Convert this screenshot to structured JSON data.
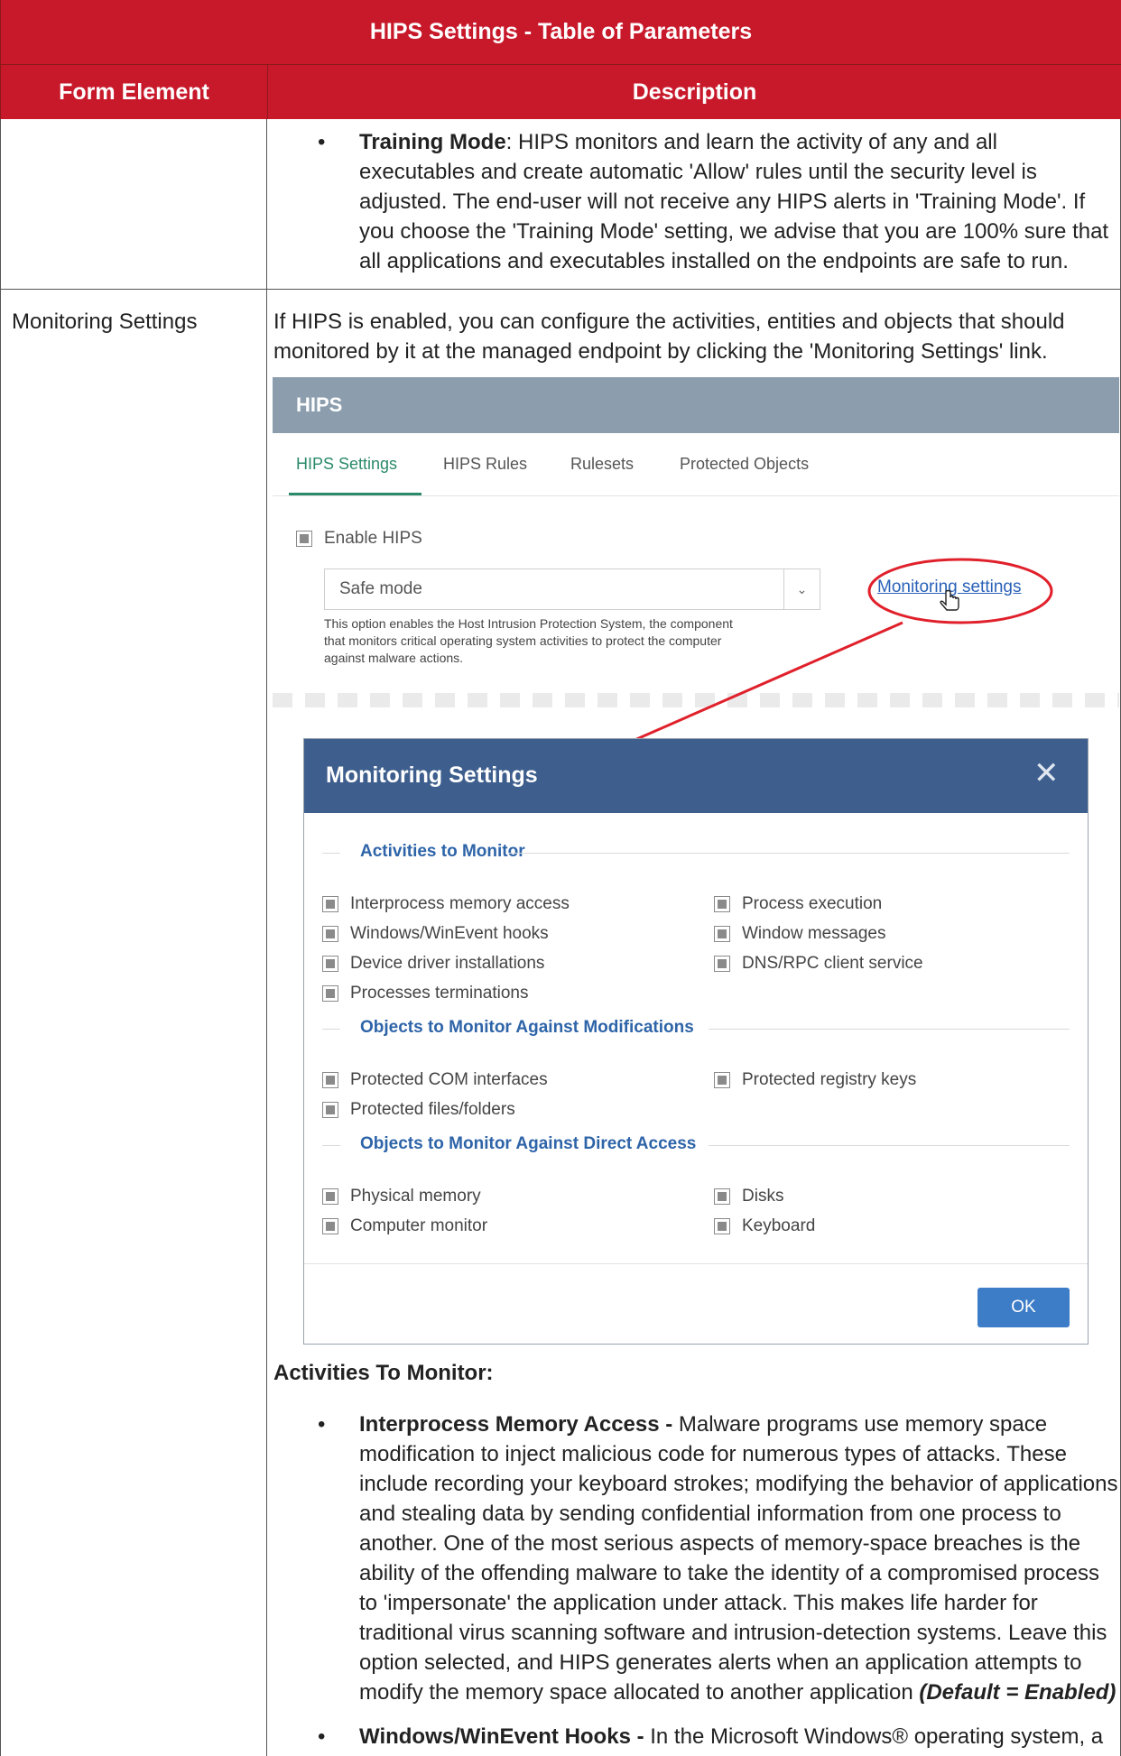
{
  "table": {
    "title": "HIPS Settings - Table of Parameters",
    "col_form": "Form Element",
    "col_desc": "Description"
  },
  "training": {
    "bullet": "•",
    "term": "Training Mode",
    "lines": [
      ": HIPS monitors and learn the activity of any and all",
      "executables and create automatic 'Allow' rules until the security level is",
      "adjusted. The end-user will not receive any HIPS alerts in 'Training Mode'. If",
      "you choose the 'Training Mode' setting, we advise that you are 100% sure that",
      "all applications and executables installed on the endpoints are safe to run."
    ]
  },
  "monitoring": {
    "form_element": "Monitoring Settings",
    "intro": [
      "If HIPS is enabled, you can configure the activities, entities and objects that should",
      "monitored by it at the managed endpoint by clicking the 'Monitoring Settings' link."
    ]
  },
  "hips_panel": {
    "title": "HIPS",
    "tabs": [
      "HIPS Settings",
      "HIPS Rules",
      "Rulesets",
      "Protected Objects"
    ],
    "enable_label": "Enable HIPS",
    "mode_value": "Safe mode",
    "link": "Monitoring settings",
    "help": [
      "This option enables the Host Intrusion Protection System, the component",
      "that monitors critical operating system activities to protect the computer",
      "against malware actions."
    ],
    "highlight_color": "#e0202b"
  },
  "dialog": {
    "title": "Monitoring Settings",
    "close": "✕",
    "sections": [
      {
        "title": "Activities to Monitor",
        "left": [
          "Interprocess memory access",
          "Windows/WinEvent hooks",
          "Device driver installations",
          "Processes terminations"
        ],
        "right": [
          "Process execution",
          "Window messages",
          "DNS/RPC client service"
        ]
      },
      {
        "title": "Objects to Monitor Against Modifications",
        "left": [
          "Protected COM interfaces",
          "Protected files/folders"
        ],
        "right": [
          "Protected registry keys"
        ]
      },
      {
        "title": "Objects to Monitor Against Direct Access",
        "left": [
          "Physical memory",
          "Computer monitor"
        ],
        "right": [
          "Disks",
          "Keyboard"
        ]
      }
    ],
    "ok": "OK"
  },
  "activities": {
    "heading": "Activities To Monitor:",
    "ipma": {
      "term": "Interprocess Memory Access -",
      "lines": [
        " Malware programs use memory space",
        "modification to inject malicious code for numerous types of attacks. These",
        "include recording your keyboard strokes; modifying the behavior of applications",
        "and stealing data by sending confidential information from one process to",
        "another. One of the most serious aspects of memory-space breaches is the",
        "ability of the offending malware to take the identity of a compromised process",
        "to 'impersonate' the application under attack. This makes life harder for",
        "traditional virus scanning software and intrusion-detection systems. Leave this",
        "option selected, and HIPS generates alerts when an application attempts to",
        "modify the memory space allocated to another application "
      ],
      "default": "(Default = Enabled)"
    },
    "hooks": {
      "term": "Windows/WinEvent Hooks -",
      "text": " In the Microsoft Windows® operating system, a"
    }
  },
  "colors": {
    "header_red": "#c8192b",
    "dialog_blue": "#3e5f8e",
    "section_blue": "#2e64a8",
    "tab_green": "#2a8a6a",
    "link_blue": "#2a62b8"
  }
}
